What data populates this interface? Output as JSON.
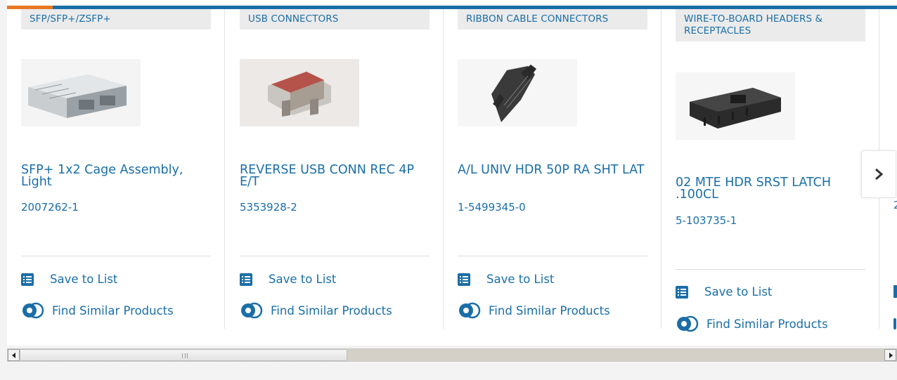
{
  "colors": {
    "brand_blue": "#1a6ea8",
    "accent_orange": "#e87722",
    "category_bg": "#ebebeb"
  },
  "carousel": {
    "cards": [
      {
        "category": "SFP/SFP+/ZSFP+",
        "title": "SFP+ 1x2 Cage Assembly, Light",
        "part_number": "2007262-1",
        "save_label": "Save to List",
        "similar_label": "Find Similar Products"
      },
      {
        "category": "USB CONNECTORS",
        "title": "REVERSE USB CONN REC 4P E/T",
        "part_number": "5353928-2",
        "save_label": "Save to List",
        "similar_label": "Find Similar Products"
      },
      {
        "category": "RIBBON CABLE CONNECTORS",
        "title": "A/L UNIV HDR 50P RA SHT LAT",
        "part_number": "1-5499345-0",
        "save_label": "Save to List",
        "similar_label": "Find Similar Products"
      },
      {
        "category": "WIRE-TO-BOARD HEADERS & RECEPTACLES",
        "title": "02 MTE HDR SRST LATCH .100CL",
        "part_number": "5-103735-1",
        "save_label": "Save to List",
        "similar_label": "Find Similar Products"
      }
    ],
    "next_icon": "chevron-right-icon",
    "partial_next_part_prefix": "2"
  },
  "scrollbar": {
    "position_fraction": 0.0
  }
}
